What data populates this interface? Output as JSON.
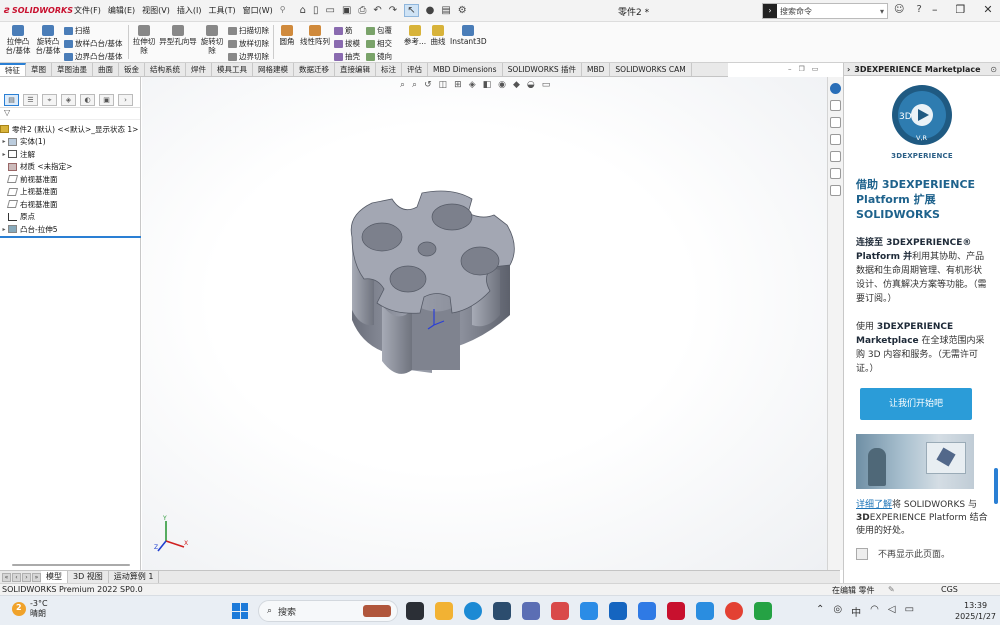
{
  "app": {
    "brand": "SOLIDWORKS",
    "doc_title": "零件2 *",
    "menu": [
      "文件(F)",
      "编辑(E)",
      "视图(V)",
      "插入(I)",
      "工具(T)",
      "窗口(W)"
    ],
    "search_placeholder": "搜索命令"
  },
  "ribbon": {
    "extrude_boss": "拉伸凸台/基体",
    "revolve_boss": "旋转凸台/基体",
    "sweep": "扫描",
    "loft_boss": "放样凸台/基体",
    "boundary_boss": "边界凸台/基体",
    "extrude_cut": "拉伸切除",
    "hole_wizard": "异型孔向导",
    "revolve_cut": "旋转切除",
    "sweep_cut": "扫描切除",
    "loft_cut": "放样切除",
    "boundary_cut": "边界切除",
    "fillet": "圆角",
    "linear_pattern": "线性阵列",
    "rib": "筋",
    "draft": "拔模",
    "shell": "抽壳",
    "wrap": "包覆",
    "intersect": "相交",
    "mirror": "镜向",
    "reference": "参考...",
    "curves": "曲线",
    "instant3d": "Instant3D"
  },
  "tabs": [
    "特征",
    "草图",
    "草图油墨",
    "曲面",
    "钣金",
    "结构系统",
    "焊件",
    "模具工具",
    "网格建模",
    "数据迁移",
    "直接编辑",
    "标注",
    "评估",
    "MBD Dimensions",
    "SOLIDWORKS 插件",
    "MBD",
    "SOLIDWORKS CAM"
  ],
  "tree": {
    "root": "零件2 (默认) <<默认>_显示状态 1>",
    "items": [
      "实体(1)",
      "注解",
      "材质 <未指定>",
      "前视基准面",
      "上视基准面",
      "右视基准面",
      "原点",
      "凸台-拉伸5"
    ]
  },
  "bottom_tabs": [
    "模型",
    "3D 视图",
    "运动算例 1"
  ],
  "status": {
    "left": "SOLIDWORKS Premium 2022 SP0.0",
    "mode": "在编辑 零件",
    "units": "CGS"
  },
  "marketplace": {
    "header": "3DEXPERIENCE Marketplace",
    "brand": "3DEXPERIENCE",
    "logo_mark": "V,R",
    "title": "借助 3DEXPERIENCE Platform 扩展 SOLIDWORKS",
    "p1_bold": "连接至 3DEXPERIENCE® Platform 并",
    "p1_rest": "利用其协助、产品数据和生命周期管理、有机形状设计、仿真解决方案等功能。（需要订阅。）",
    "p2_prefix": "使用 ",
    "p2_bold": "3DEXPERIENCE Marketplace",
    "p2_rest": " 在全球范围内采购 3D 内容和服务。（无需许可证。）",
    "cta": "让我们开始吧",
    "more_link": "详细了解",
    "more_mid1": "将 SOLIDWORKS 与 ",
    "more_bold": "3D",
    "more_rest": "EXPERIENCE Platform 结合使用的好处。",
    "dont_show": "不再显示此页面。"
  },
  "taskbar": {
    "temp": "-3°C",
    "weather": "晴朗",
    "search": "搜索",
    "time": "13:39",
    "date": "2025/1/27",
    "ime": "中"
  }
}
